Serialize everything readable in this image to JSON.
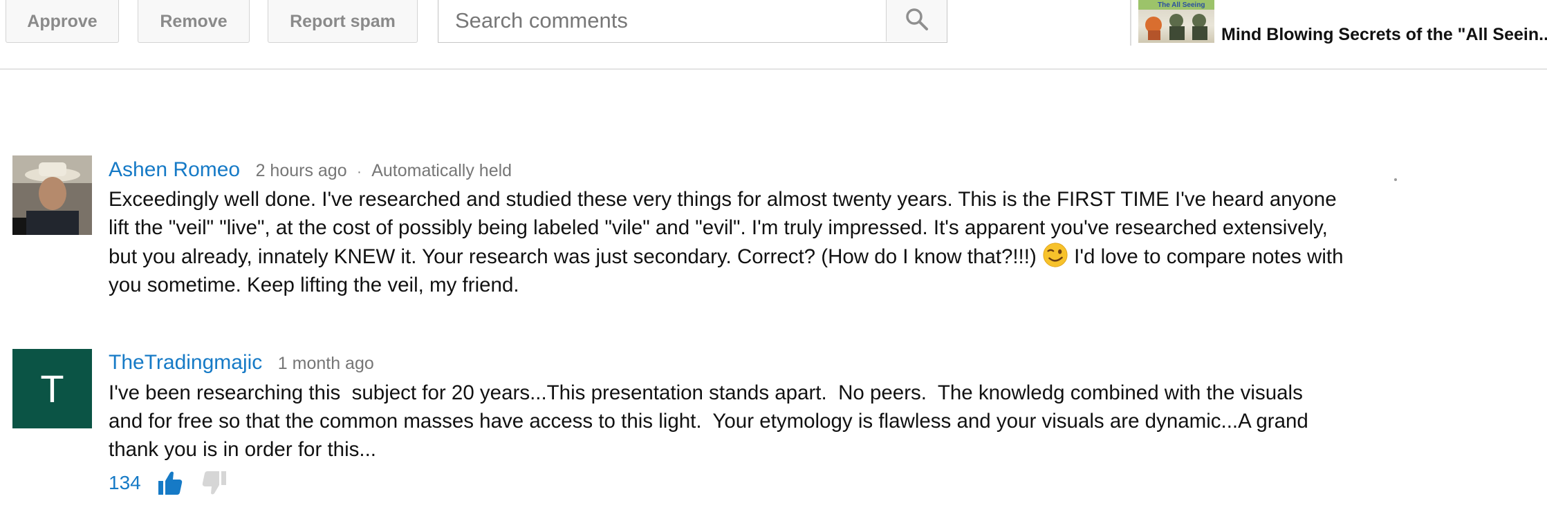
{
  "toolbar": {
    "approve_label": "Approve",
    "remove_label": "Remove",
    "report_spam_label": "Report spam",
    "search": {
      "placeholder": "Search comments",
      "value": ""
    }
  },
  "video": {
    "thumbnail_text": "The All Seeing",
    "title": "Mind Blowing Secrets of the \"All Seein..."
  },
  "comments": [
    {
      "author": "Ashen Romeo",
      "time": "2 hours ago",
      "separator": "·",
      "status": "Automatically held",
      "text_before_emoji": "Exceedingly well done. I've researched and studied these very things for almost twenty years. This is the FIRST TIME I've heard anyone lift the \"veil\" \"live\", at the cost of possibly being labeled \"vile\" and \"evil\". I'm truly impressed. It's apparent you've researched extensively, but you already, innately KNEW it. Your research was just secondary. Correct? (How do I know that?!!!) ",
      "emoji": "winking-face",
      "text_after_emoji": " I'd love to compare notes with you sometime. Keep lifting the veil, my friend."
    },
    {
      "author": "TheTradingmajic",
      "avatar_letter": "T",
      "avatar_color": "#0b5445",
      "time": "1 month ago",
      "text": "I've been researching this  subject for 20 years...This presentation stands apart.  No peers.  The knowledg combined with the visuals and for free so that the common masses have access to this light.  Your etymology is flawless and your visuals are dynamic...A grand thank you is in order for this...",
      "like_count": "134"
    }
  ],
  "colors": {
    "link_blue": "#167ac6",
    "meta_gray": "#767676",
    "button_text": "#8a8a8a",
    "button_bg": "#f8f8f8"
  }
}
